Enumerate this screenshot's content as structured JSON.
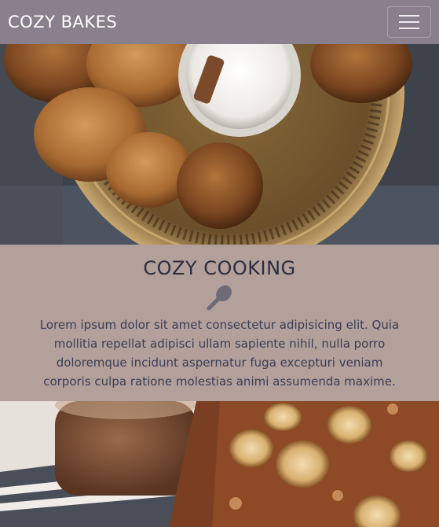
{
  "navbar": {
    "brand": "COZY BAKES",
    "menu_icon": "hamburger-menu-icon"
  },
  "hero": {
    "image": "cookies-and-milk-photo"
  },
  "section": {
    "title": "COZY COOKING",
    "icon": "spoon-icon",
    "text": "Lorem ipsum dolor sit amet consectetur adipisicing elit. Quia mollitia repellat adipisci ullam sapiente nihil, nulla porro doloremque incidunt aspernatur fuga excepturi veniam corporis culpa ratione molestias animi assumenda maxime."
  },
  "bottom": {
    "image": "banana-bread-photo"
  },
  "colors": {
    "navbar": "#8a7f8c",
    "section_bg": "#b3a09b",
    "heading": "#2a2d3e"
  }
}
